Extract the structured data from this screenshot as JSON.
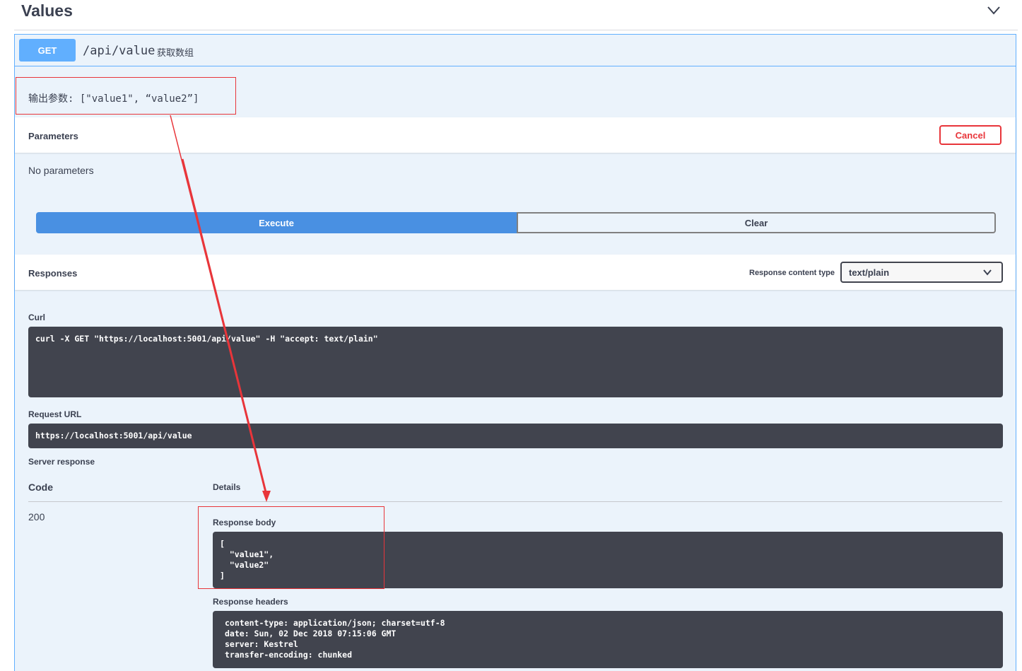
{
  "section": {
    "title": "Values"
  },
  "operation": {
    "method": "GET",
    "path": "/api/value",
    "summary": "获取数组",
    "description": "输出参数: [\"value1\", “value2”]"
  },
  "parameters": {
    "title": "Parameters",
    "cancel_label": "Cancel",
    "empty_text": "No parameters"
  },
  "actions": {
    "execute_label": "Execute",
    "clear_label": "Clear"
  },
  "responses": {
    "title": "Responses",
    "content_type_label": "Response content type",
    "content_type_value": "text/plain"
  },
  "curl": {
    "label": "Curl",
    "command": "curl -X GET \"https://localhost:5001/api/value\" -H \"accept: text/plain\""
  },
  "request_url": {
    "label": "Request URL",
    "value": "https://localhost:5001/api/value"
  },
  "server_response": {
    "label": "Server response",
    "code_header": "Code",
    "details_header": "Details",
    "code": "200",
    "body_label": "Response body",
    "body": "[\n  \"value1\",\n  \"value2\"\n]",
    "headers_label": "Response headers",
    "headers": "content-type: application/json; charset=utf-8\ndate: Sun, 02 Dec 2018 07:15:06 GMT\nserver: Kestrel\ntransfer-encoding: chunked"
  },
  "colors": {
    "get_method": "#61affe",
    "execute": "#4990e2",
    "cancel": "#e8353a",
    "annotation": "#e8353a",
    "code_bg": "#41444e"
  }
}
